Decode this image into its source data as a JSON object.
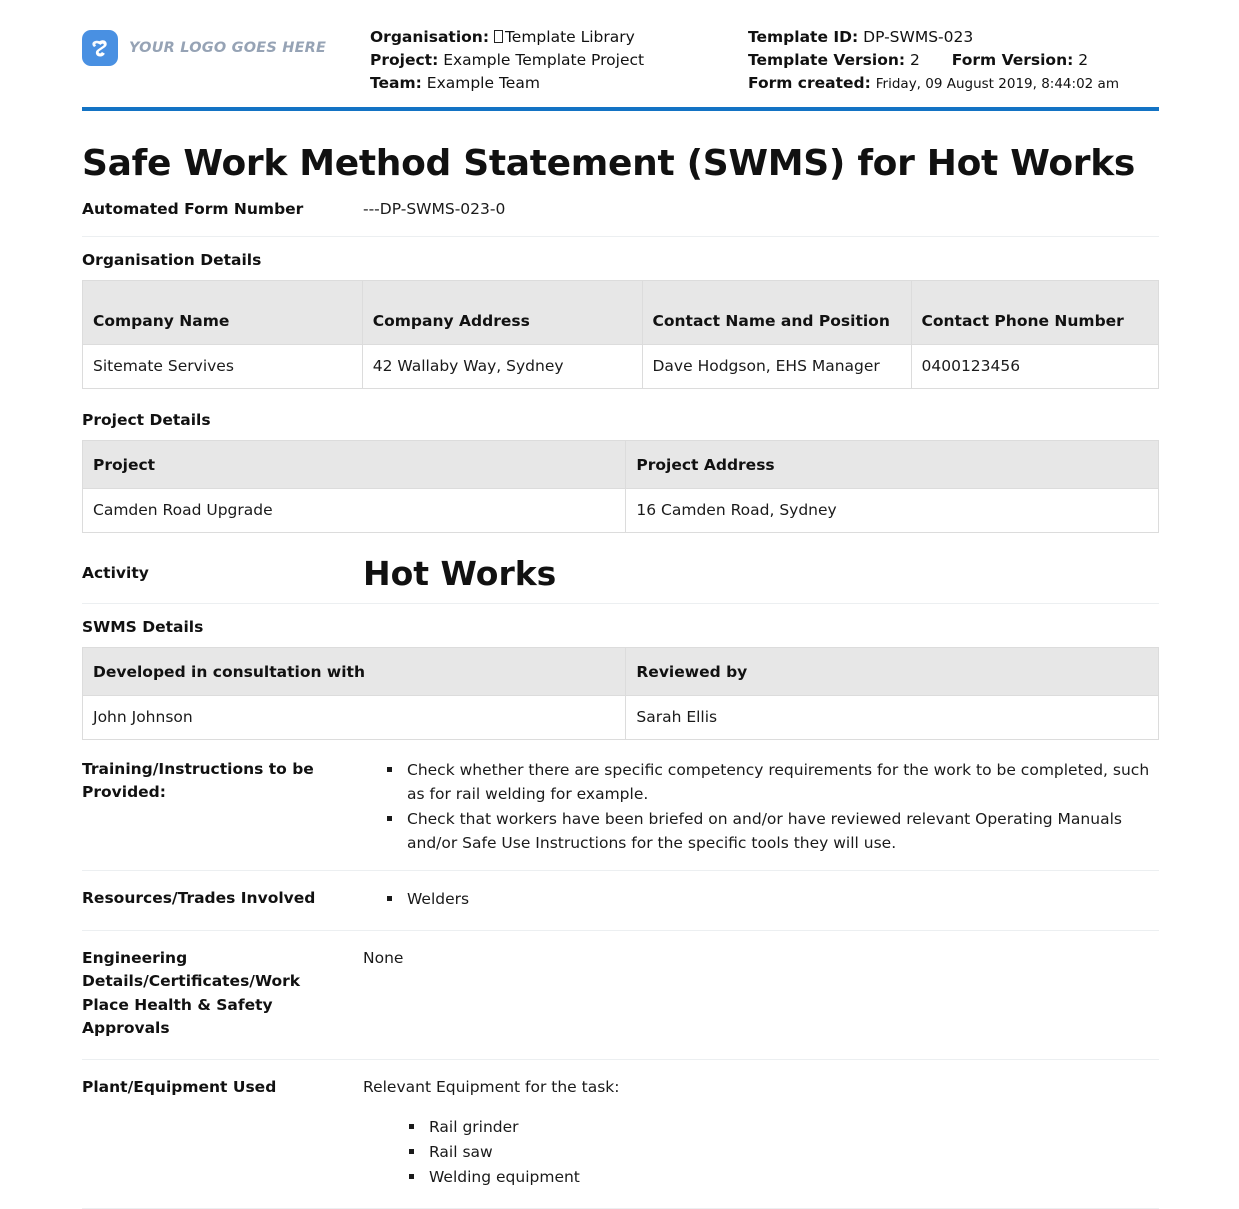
{
  "header": {
    "logo_alt": "YOUR LOGO GOES HERE",
    "organisation_label": "Organisation:",
    "organisation_value": "Template Library",
    "project_label": "Project:",
    "project_value": "Example Template Project",
    "team_label": "Team:",
    "team_value": "Example Team",
    "template_id_label": "Template ID:",
    "template_id_value": "DP-SWMS-023",
    "template_version_label": "Template Version:",
    "template_version_value": "2",
    "form_version_label": "Form Version:",
    "form_version_value": "2",
    "form_created_label": "Form created:",
    "form_created_value": "Friday, 09 August 2019, 8:44:02 am",
    "accent_color": "#1373c4",
    "logo_color": "#4990e2"
  },
  "title": "Safe Work Method Statement (SWMS) for Hot Works",
  "automated_form": {
    "label": "Automated Form Number",
    "value": "---DP-SWMS-023-0"
  },
  "organisation_details": {
    "heading": "Organisation Details",
    "columns": [
      "Company Name",
      "Company Address",
      "Contact Name and Position",
      "Contact Phone Number"
    ],
    "rows": [
      [
        "Sitemate Servives",
        "42 Wallaby Way, Sydney",
        "Dave Hodgson, EHS Manager",
        "0400123456"
      ]
    ]
  },
  "project_details": {
    "heading": "Project Details",
    "columns": [
      "Project",
      "Project Address"
    ],
    "rows": [
      [
        "Camden Road Upgrade",
        "16 Camden Road, Sydney"
      ]
    ]
  },
  "activity": {
    "label": "Activity",
    "value": "Hot Works"
  },
  "swms_details": {
    "heading": "SWMS Details",
    "columns": [
      "Developed in consultation with",
      "Reviewed by"
    ],
    "rows": [
      [
        "John Johnson",
        "Sarah Ellis"
      ]
    ]
  },
  "training": {
    "label": "Training/Instructions to be Provided:",
    "bullets": [
      "Check whether there are specific competency requirements for the work to be completed, such as for rail welding for example.",
      "Check that workers have been briefed on and/or have reviewed relevant Operating Manuals and/or Safe Use Instructions for the specific tools they will use."
    ]
  },
  "resources": {
    "label": "Resources/Trades Involved",
    "bullets": [
      "Welders"
    ]
  },
  "engineering": {
    "label": "Engineering Details/Certificates/Work Place Health & Safety Approvals",
    "value": "None"
  },
  "plant_equipment": {
    "label": "Plant/Equipment Used",
    "lead": "Relevant Equipment for the task:",
    "bullets": [
      "Rail grinder",
      "Rail saw",
      "Welding equipment"
    ]
  }
}
